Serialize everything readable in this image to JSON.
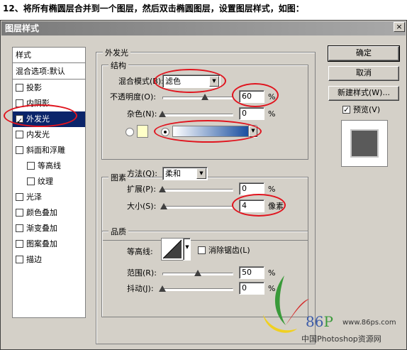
{
  "caption": "12、将所有椭圆层合并到一个图层，然后双击椭圆图层，设置图层样式，如图：",
  "dialog": {
    "title": "图层样式",
    "close_glyph": "×"
  },
  "sidebar": {
    "styles_header": "样式",
    "blend_header": "混合选项:默认",
    "items": [
      {
        "label": "投影",
        "checked": false
      },
      {
        "label": "内阴影",
        "checked": false
      },
      {
        "label": "外发光",
        "checked": true,
        "selected": true
      },
      {
        "label": "内发光",
        "checked": false
      },
      {
        "label": "斜面和浮雕",
        "checked": false
      },
      {
        "label": "等高线",
        "checked": false,
        "indent": true
      },
      {
        "label": "纹理",
        "checked": false,
        "indent": true
      },
      {
        "label": "光泽",
        "checked": false
      },
      {
        "label": "颜色叠加",
        "checked": false
      },
      {
        "label": "渐变叠加",
        "checked": false
      },
      {
        "label": "图案叠加",
        "checked": false
      },
      {
        "label": "描边",
        "checked": false
      }
    ]
  },
  "outer_glow": {
    "title": "外发光",
    "structure": {
      "title": "结构",
      "blend_mode_label": "混合模式(B):",
      "blend_mode_value": "滤色",
      "opacity_label": "不透明度(O):",
      "opacity_value": "60",
      "opacity_unit": "%",
      "opacity_fraction": 0.6,
      "noise_label": "杂色(N):",
      "noise_value": "0",
      "noise_unit": "%",
      "noise_fraction": 0.0,
      "solid_color": "#ffffc8",
      "gradient_start": "#ffffff",
      "gradient_end": "#1a4fa0",
      "gradient_selected": true
    },
    "elements": {
      "title": "图素",
      "method_label": "方法(Q):",
      "method_value": "柔和",
      "spread_label": "扩展(P):",
      "spread_value": "0",
      "spread_unit": "%",
      "spread_fraction": 0.0,
      "size_label": "大小(S):",
      "size_value": "4",
      "size_unit": "像素",
      "size_fraction": 0.02
    },
    "quality": {
      "title": "品质",
      "contour_label": "等高线:",
      "anti_alias_label": "消除锯齿(L)",
      "anti_alias_checked": false,
      "range_label": "范围(R):",
      "range_value": "50",
      "range_unit": "%",
      "range_fraction": 0.5,
      "jitter_label": "抖动(J):",
      "jitter_value": "0",
      "jitter_unit": "%",
      "jitter_fraction": 0.0
    }
  },
  "buttons": {
    "ok": "确定",
    "cancel": "取消",
    "new_style": "新建样式(W)...",
    "preview_label": "预览(V)",
    "preview_checked": true
  },
  "watermark": {
    "brand": "86",
    "brand_p": "P",
    "url": "www.86ps.com",
    "site": "中国Photoshop资源网"
  },
  "colors": {
    "highlight_red": "#e0141e",
    "selection_blue": "#0a246a",
    "dialog_gray": "#d4d0c8"
  }
}
